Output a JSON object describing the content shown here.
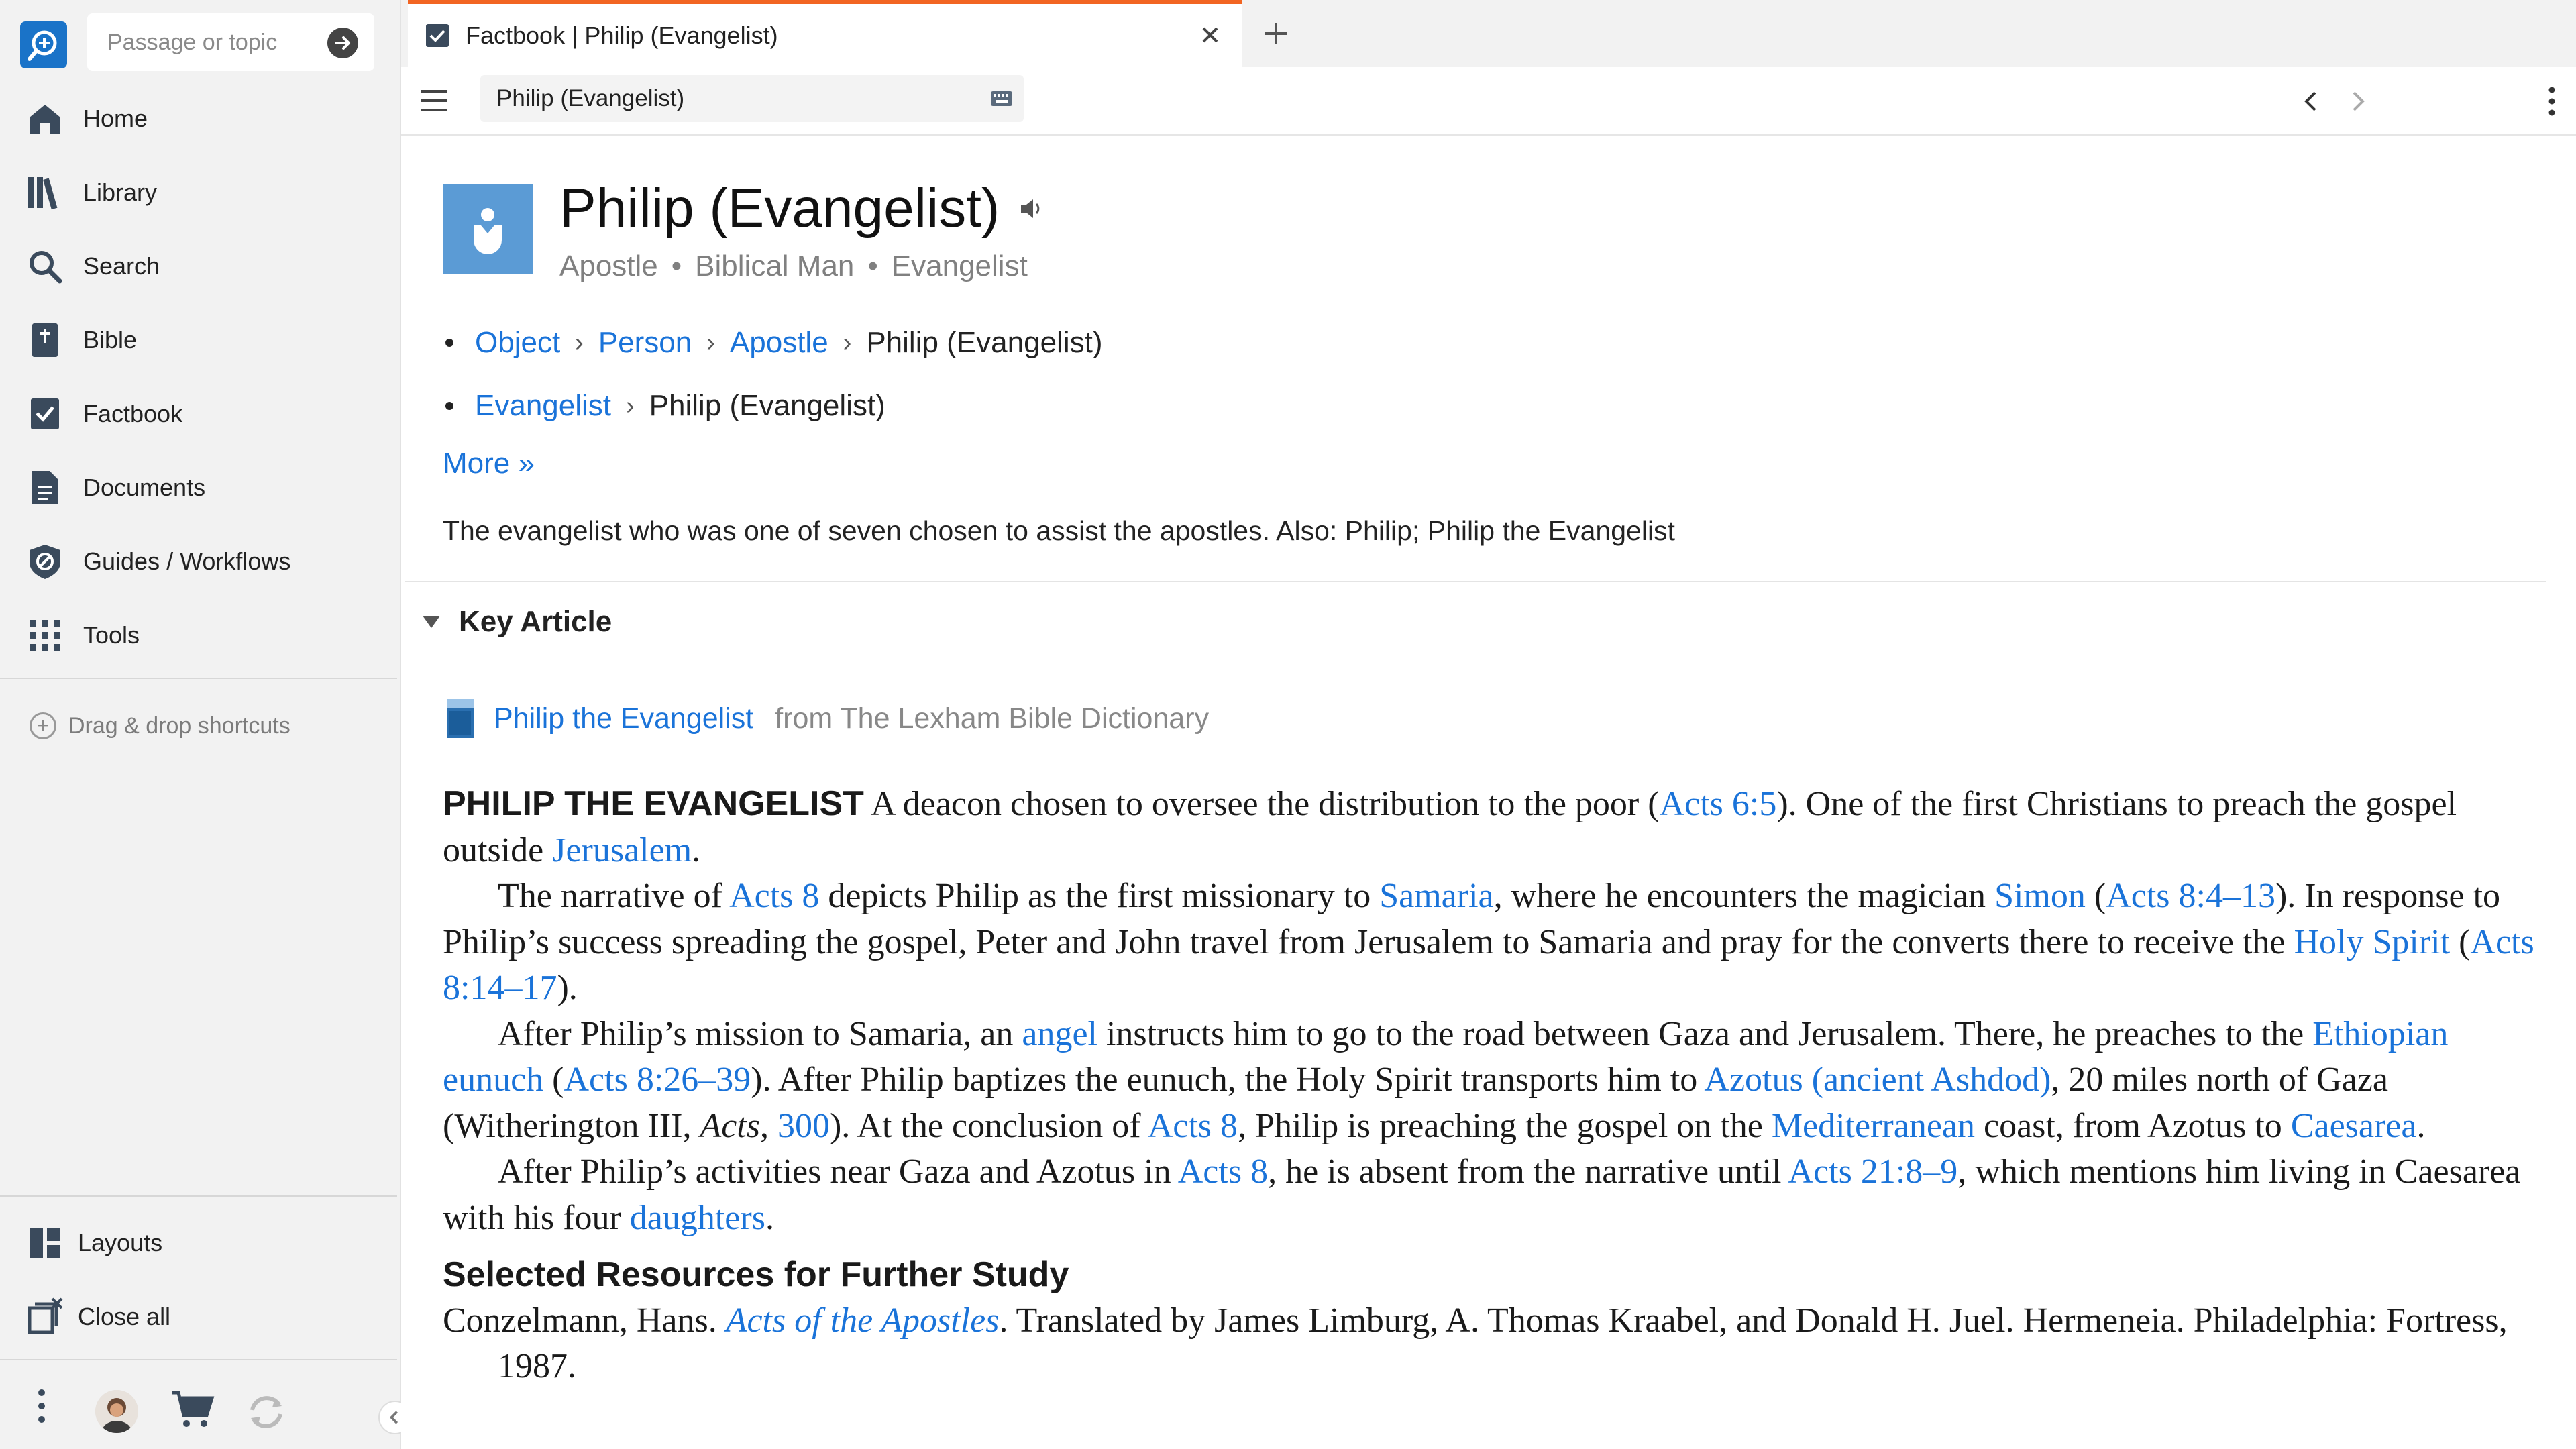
{
  "sidebar": {
    "search_placeholder": "Passage or topic",
    "items": [
      {
        "label": "Home",
        "icon": "home-icon"
      },
      {
        "label": "Library",
        "icon": "library-icon"
      },
      {
        "label": "Search",
        "icon": "search-icon"
      },
      {
        "label": "Bible",
        "icon": "bible-icon"
      },
      {
        "label": "Factbook",
        "icon": "factbook-icon"
      },
      {
        "label": "Documents",
        "icon": "documents-icon"
      },
      {
        "label": "Guides / Workflows",
        "icon": "guides-icon"
      },
      {
        "label": "Tools",
        "icon": "tools-grid-icon"
      }
    ],
    "drag_drop": "Drag & drop shortcuts",
    "bottom_items": [
      {
        "label": "Layouts",
        "icon": "layouts-icon"
      },
      {
        "label": "Close all",
        "icon": "close-all-icon"
      }
    ]
  },
  "tab": {
    "title": "Factbook | Philip (Evangelist)",
    "accent": "#f26522"
  },
  "toolbar": {
    "reference_value": "Philip (Evangelist)"
  },
  "entry": {
    "title": "Philip (Evangelist)",
    "types": [
      "Apostle",
      "Biblical Man",
      "Evangelist"
    ],
    "breadcrumbs": [
      {
        "links": [
          "Object",
          "Person",
          "Apostle"
        ],
        "current": "Philip (Evangelist)"
      },
      {
        "links": [
          "Evangelist"
        ],
        "current": "Philip (Evangelist)"
      }
    ],
    "more": "More »",
    "description": "The evangelist who was one of seven chosen to assist the apostles. Also: Philip; Philip the Evangelist"
  },
  "key_article": {
    "heading": "Key Article",
    "source_title": "Philip the Evangelist",
    "source_from": "from The Lexham Bible Dictionary"
  },
  "article": {
    "p1": [
      {
        "t": "PHILIP THE EVANGELIST",
        "k": "hd"
      },
      {
        "t": " A deacon chosen to oversee the distribution to the poor ("
      },
      {
        "t": "Acts 6:5",
        "k": "a"
      },
      {
        "t": "). One of the first Christians to preach the gospel outside "
      },
      {
        "t": "Jerusalem",
        "k": "a"
      },
      {
        "t": "."
      }
    ],
    "p2": [
      {
        "t": "The narrative of "
      },
      {
        "t": "Acts 8",
        "k": "a"
      },
      {
        "t": " depicts Philip as the first missionary to "
      },
      {
        "t": "Samaria",
        "k": "a"
      },
      {
        "t": ", where he encounters the magician "
      },
      {
        "t": "Simon",
        "k": "a"
      },
      {
        "t": " ("
      },
      {
        "t": "Acts 8:4–13",
        "k": "a"
      },
      {
        "t": "). In response to Philip’s success spreading the gospel, Peter and John travel from Jerusalem to Samaria and pray for the converts there to receive the "
      },
      {
        "t": "Holy Spirit",
        "k": "a"
      },
      {
        "t": " ("
      },
      {
        "t": "Acts 8:14–17",
        "k": "a"
      },
      {
        "t": ")."
      }
    ],
    "p3": [
      {
        "t": "After Philip’s mission to Samaria, an "
      },
      {
        "t": "angel",
        "k": "a"
      },
      {
        "t": " instructs him to go to the road between Gaza and Jerusalem. There, he preaches to the "
      },
      {
        "t": "Ethiopian eunuch",
        "k": "a"
      },
      {
        "t": " ("
      },
      {
        "t": "Acts 8:26–39",
        "k": "a"
      },
      {
        "t": "). After Philip baptizes the eunuch, the Holy Spirit transports him to "
      },
      {
        "t": "Azotus (ancient Ashdod)",
        "k": "a"
      },
      {
        "t": ", 20 miles north of Gaza (Witherington III, "
      },
      {
        "t": "Acts",
        "k": "i"
      },
      {
        "t": ", "
      },
      {
        "t": "300",
        "k": "a"
      },
      {
        "t": "). At the conclusion of "
      },
      {
        "t": "Acts 8",
        "k": "a"
      },
      {
        "t": ", Philip is preaching the gospel on the "
      },
      {
        "t": "Mediterranean",
        "k": "a"
      },
      {
        "t": " coast, from Azotus to "
      },
      {
        "t": "Caesarea",
        "k": "a"
      },
      {
        "t": "."
      }
    ],
    "p4": [
      {
        "t": "After Philip’s activities near Gaza and Azotus in "
      },
      {
        "t": "Acts 8",
        "k": "a"
      },
      {
        "t": ", he is absent from the narrative until "
      },
      {
        "t": "Acts 21:8–9",
        "k": "a"
      },
      {
        "t": ", which mentions him living in Caesarea with his four "
      },
      {
        "t": "daughters",
        "k": "a"
      },
      {
        "t": "."
      }
    ],
    "study_heading": "Selected Resources for Further Study",
    "study1": [
      {
        "t": "Conzelmann, Hans. "
      },
      {
        "t": "Acts of the Apostles",
        "k": "ai"
      },
      {
        "t": ". Translated by James Limburg, A. Thomas Kraabel, and Donald H. Juel. Hermeneia. Philadelphia: Fortress, 1987."
      }
    ]
  },
  "colors": {
    "link": "#1a73d9",
    "avatar_bg": "#5b9bd5",
    "logo_bg": "#1a73c8"
  }
}
